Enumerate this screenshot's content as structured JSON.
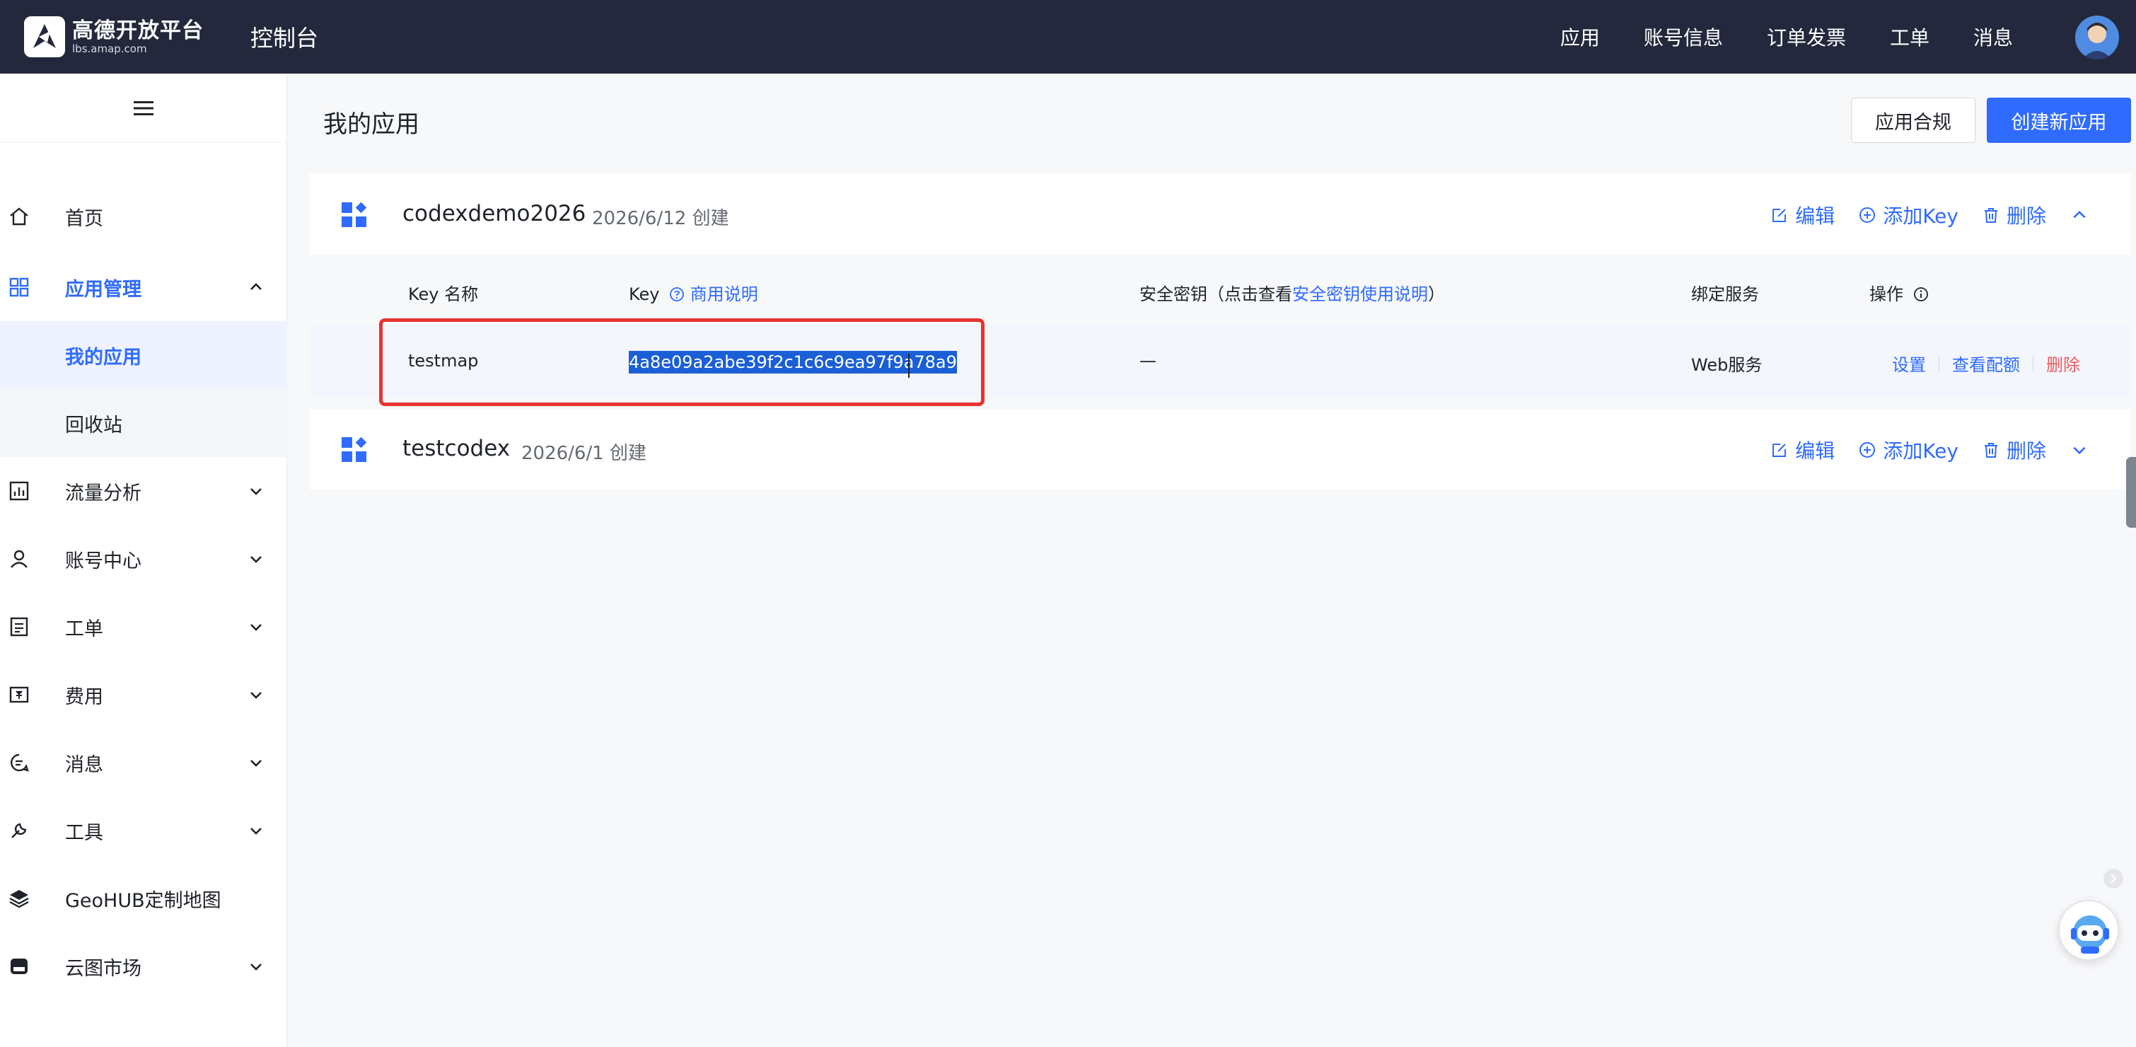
{
  "header": {
    "logo_name": "高德开放平台",
    "logo_sub": "lbs.amap.com",
    "console_title": "控制台",
    "nav": [
      "应用",
      "账号信息",
      "订单发票",
      "工单",
      "消息"
    ]
  },
  "sidebar": {
    "items": [
      {
        "label": "首页",
        "icon": "home-icon"
      },
      {
        "label": "应用管理",
        "icon": "grid-icon",
        "expanded": true
      },
      {
        "label": "我的应用",
        "sub": true,
        "selected": true
      },
      {
        "label": "回收站",
        "sub": true
      },
      {
        "label": "流量分析",
        "icon": "chart-icon"
      },
      {
        "label": "账号中心",
        "icon": "user-icon"
      },
      {
        "label": "工单",
        "icon": "ticket-icon"
      },
      {
        "label": "费用",
        "icon": "billing-icon"
      },
      {
        "label": "消息",
        "icon": "message-icon"
      },
      {
        "label": "工具",
        "icon": "wrench-icon"
      },
      {
        "label": "GeoHUB定制地图",
        "icon": "layers-icon"
      },
      {
        "label": "云图市场",
        "icon": "store-icon"
      }
    ]
  },
  "main": {
    "title": "我的应用",
    "compliance_button": "应用合规",
    "create_button": "创建新应用",
    "apps": [
      {
        "name": "codexdemo2026",
        "date": "2026/6/12 创建",
        "edit": "编辑",
        "add_key": "添加Key",
        "delete": "删除",
        "table": {
          "col_key_name": "Key 名称",
          "col_key": "Key",
          "col_key_link": "商用说明",
          "col_secret_prefix": "安全密钥（点击查看",
          "col_secret_link": "安全密钥使用说明",
          "col_secret_suffix": "）",
          "col_service": "绑定服务",
          "col_ops": "操作",
          "rows": [
            {
              "key_name": "testmap",
              "key": "4a8e09a2abe39f2c1c6c9ea97f9a78a9",
              "secret": "—",
              "service": "Web服务",
              "op_settings": "设置",
              "op_quota": "查看配额",
              "op_delete": "删除"
            }
          ]
        }
      },
      {
        "name": "testcodex",
        "date": "2026/6/1 创建",
        "edit": "编辑",
        "add_key": "添加Key",
        "delete": "删除"
      }
    ]
  },
  "colors": {
    "header_bg": "#23283c",
    "accent": "#2f6bff",
    "danger": "#f05a5a",
    "highlight": "#e8332f"
  }
}
